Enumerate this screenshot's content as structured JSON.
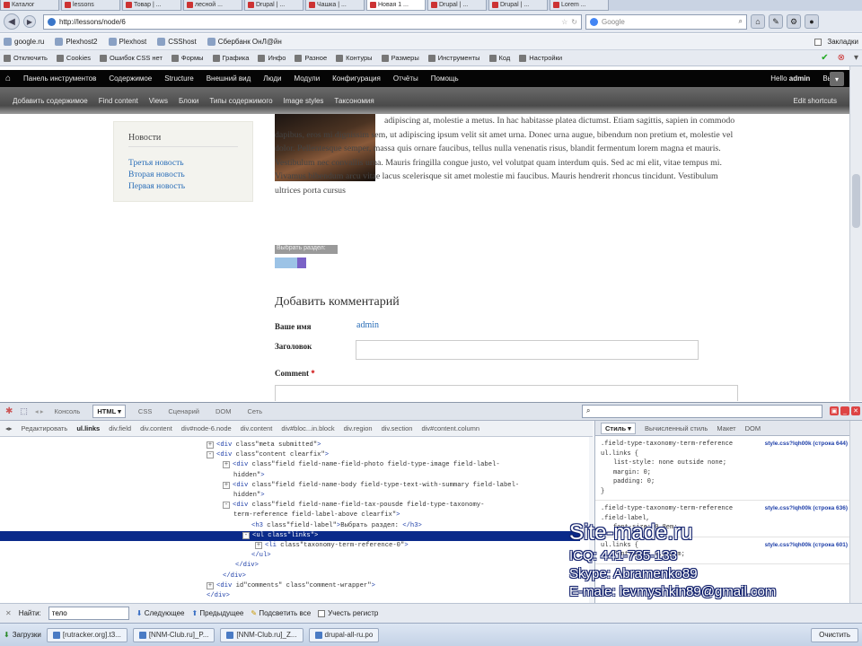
{
  "browser": {
    "tabs": [
      {
        "label": "Каталог"
      },
      {
        "label": "lessons"
      },
      {
        "label": "Товар | ..."
      },
      {
        "label": "лесной ..."
      },
      {
        "label": "Drupal | ..."
      },
      {
        "label": "Чашка | ..."
      },
      {
        "label": "Новая 1 ...",
        "active": true
      },
      {
        "label": "Drupal | ..."
      },
      {
        "label": "Drupal | ..."
      },
      {
        "label": "Lorem ..."
      }
    ],
    "url": "http://lessons/node/6",
    "search_placeholder": "Google",
    "bookmarks": [
      "google.ru",
      "Plexhost2",
      "Plexhost",
      "CSShost",
      "Сбербанк ОнЛ@йн"
    ],
    "bookmarks_right": "Закладки",
    "devbar": [
      "Отключить",
      "Cookies",
      "Ошибок CSS нет",
      "Формы",
      "Графика",
      "Инфо",
      "Разное",
      "Контуры",
      "Размеры",
      "Инструменты",
      "Код",
      "Настройки"
    ]
  },
  "admin_toolbar": {
    "items": [
      "Панель инструментов",
      "Содержимое",
      "Structure",
      "Внешний вид",
      "Люди",
      "Модули",
      "Конфигурация",
      "Отчёты",
      "Помощь"
    ],
    "hello": "Hello",
    "user": "admin",
    "logout": "Выйти"
  },
  "shortcuts": {
    "items": [
      "Добавить содержимое",
      "Find content",
      "Views",
      "Блоки",
      "Типы содержимого",
      "Image styles",
      "Таксономия"
    ],
    "edit": "Edit shortcuts"
  },
  "sidebar": {
    "title": "Новости",
    "links": [
      "Третья новость",
      "Вторая новость",
      "Первая новость"
    ]
  },
  "article": {
    "body": "adipiscing at, molestie a metus. In hac habitasse platea dictumst. Etiam sagittis, sapien in commodo dapibus, eros mi dignissim sem, ut adipiscing ipsum velit sit amet urna. Donec urna augue, bibendum non pretium et, molestie vel dolor. Pellentesque semper, massa quis ornare faucibus, tellus nulla venenatis risus, blandit fermentum lorem magna et mauris. Vestibulum nec convallis urna. Mauris fringilla congue justo, vel volutpat quam interdum quis. Sed ac mi elit, vitae tempus mi. Vivamus bibendum arcu vitae lacus scelerisque sit amet molestie mi faucibus. Mauris hendrerit rhoncus tincidunt. Vestibulum ultrices porta cursus",
    "term_label": "Выбрать раздел:"
  },
  "comment_form": {
    "title": "Добавить комментарий",
    "name_label": "Ваше имя",
    "name_value": "admin",
    "subject_label": "Заголовок",
    "comment_label": "Comment",
    "required_mark": "*"
  },
  "firebug": {
    "tabs": [
      "Консоль",
      "HTML",
      "CSS",
      "Сценарий",
      "DOM",
      "Сеть"
    ],
    "selected_tab": "HTML",
    "crumbs": [
      "Редактировать",
      "ul.links",
      "div.field",
      "div.content",
      "div#node-6.node",
      "div.content",
      "div#bloc...in.block",
      "div.region",
      "div.section",
      "div#content.column"
    ],
    "html_lines": [
      {
        "indent": 230,
        "twisty": "+",
        "text": "<div class=\"meta submitted\">"
      },
      {
        "indent": 230,
        "twisty": "-",
        "text": "<div class=\"content clearfix\">"
      },
      {
        "indent": 248,
        "twisty": "+",
        "text": "<div class=\"field field-name-field-photo field-type-image field-label-"
      },
      {
        "indent": 260,
        "twisty": "",
        "text": "hidden\">"
      },
      {
        "indent": 248,
        "twisty": "+",
        "text": "<div class=\"field field-name-body field-type-text-with-summary field-label-"
      },
      {
        "indent": 260,
        "twisty": "",
        "text": "hidden\">"
      },
      {
        "indent": 248,
        "twisty": "-",
        "text": "<div class=\"field field-name-field-tax-pousde field-type-taxonomy-"
      },
      {
        "indent": 260,
        "twisty": "",
        "text": "term-reference field-label-above clearfix\">"
      },
      {
        "indent": 280,
        "twisty": "",
        "text": "<h3 class=\"field-label\">Выбрать раздел: </h3>"
      },
      {
        "indent": 270,
        "twisty": "-",
        "text": "<ul class=\"links\">",
        "selected": true
      },
      {
        "indent": 284,
        "twisty": "+",
        "text": "<li class=\"taxonomy-term-reference-0\">"
      },
      {
        "indent": 280,
        "twisty": "",
        "text": "</ul>"
      },
      {
        "indent": 262,
        "twisty": "",
        "text": "</div>"
      },
      {
        "indent": 248,
        "twisty": "",
        "text": "</div>"
      },
      {
        "indent": 230,
        "twisty": "+",
        "text": "<div id=\"comments\" class=\"comment-wrapper\">"
      },
      {
        "indent": 230,
        "twisty": "",
        "text": "</div>"
      }
    ],
    "side_tabs": [
      "Стиль",
      "Вычисленный стиль",
      "Макет",
      "DOM"
    ],
    "selected_side_tab": "Стиль",
    "rules": [
      {
        "selector": ".field-type-taxonomy-term-reference ul.links {",
        "source": "style.css?lqh00k (строка 644)",
        "props": [
          "list-style: none outside none;",
          "margin: 0;",
          "padding: 0;"
        ],
        "close": "}"
      },
      {
        "selector": ".field-type-taxonomy-term-reference .field-label,",
        "source": "style.css?lqh00k (строка 636)",
        "props": [
          "font-size: 0.8em;"
        ],
        "close": ""
      },
      {
        "selector": "ul.links {",
        "source": "style.css?lqh00k (строка 601)",
        "props": [
          "font-size: 0.923em;"
        ],
        "close": ""
      }
    ]
  },
  "findbar": {
    "label": "Найти:",
    "value": "тело",
    "next": "Следующее",
    "prev": "Предыдущее",
    "highlight": "Подсветить все",
    "match_case": "Учесть регистр"
  },
  "taskbar": {
    "downloads": "Загрузки",
    "tasks": [
      "[rutracker.org].t3...",
      "[NNM-Club.ru]_P...",
      "[NNM-Club.ru]_Z...",
      "drupal-all-ru.po"
    ],
    "clear": "Очистить"
  },
  "watermark": {
    "site": "Site-made.ru",
    "icq": "ICQ: 441-735-133",
    "skype": "Skype: Abramenko89",
    "email": "E-male: levmyshkin89@gmail.com"
  }
}
